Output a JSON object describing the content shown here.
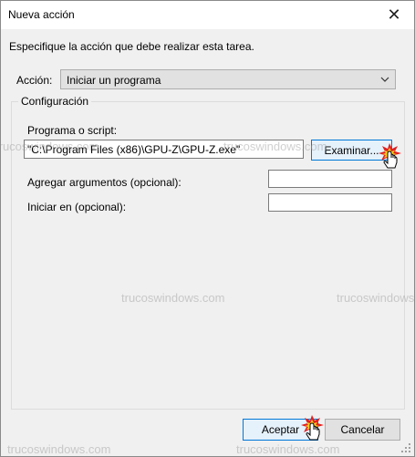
{
  "window": {
    "title": "Nueva acción",
    "close_glyph": "✕"
  },
  "instruction": "Especifique la acción que debe realizar esta tarea.",
  "action": {
    "label": "Acción:",
    "value": "Iniciar un programa"
  },
  "config": {
    "legend": "Configuración",
    "program_label": "Programa o script:",
    "program_value": "\"C:\\Program Files (x86)\\GPU-Z\\GPU-Z.exe\"",
    "browse_label": "Examinar...",
    "args_label": "Agregar argumentos (opcional):",
    "args_value": "",
    "start_label": "Iniciar en (opcional):",
    "start_value": ""
  },
  "buttons": {
    "accept": "Aceptar",
    "cancel": "Cancelar"
  },
  "watermark": "trucoswindows.com",
  "colors": {
    "accent": "#0078d7",
    "button_focus_bg": "#e5f1fb",
    "button_bg": "#e1e1e1",
    "window_bg": "#f0f0f0"
  }
}
